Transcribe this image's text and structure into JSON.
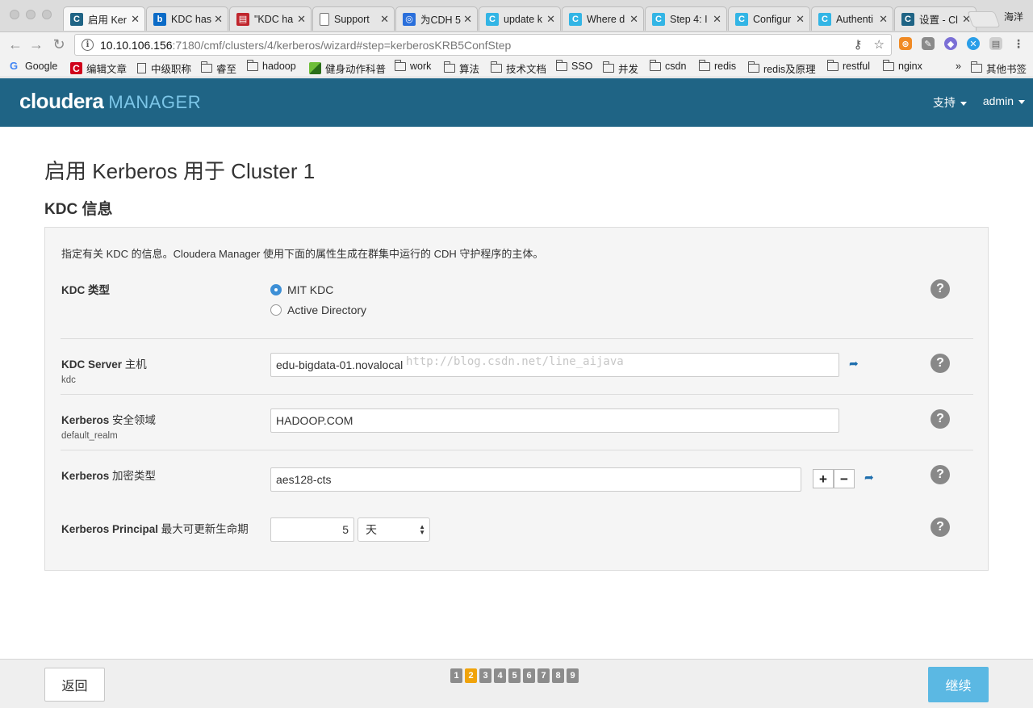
{
  "browser": {
    "profile": "海洋",
    "tabs": [
      {
        "title": "启用 Ker",
        "fav": "C",
        "color": "#1f6485",
        "active": true
      },
      {
        "title": "KDC has",
        "fav": "b",
        "color": "#0b6bc7",
        "active": false
      },
      {
        "title": "\"KDC ha",
        "fav": "▤",
        "color": "#c0262d",
        "active": false
      },
      {
        "title": "Support",
        "fav": "",
        "color": "#ffffff",
        "active": false
      },
      {
        "title": "为CDH 5",
        "fav": "◎",
        "color": "#2a6fdb",
        "active": false
      },
      {
        "title": "update k",
        "fav": "C",
        "color": "#33b5e5",
        "active": false
      },
      {
        "title": "Where d",
        "fav": "C",
        "color": "#33b5e5",
        "active": false
      },
      {
        "title": "Step 4: I",
        "fav": "C",
        "color": "#33b5e5",
        "active": false
      },
      {
        "title": "Configur",
        "fav": "C",
        "color": "#33b5e5",
        "active": false
      },
      {
        "title": "Authenti",
        "fav": "C",
        "color": "#33b5e5",
        "active": false
      },
      {
        "title": "设置 - Cl",
        "fav": "C",
        "color": "#1f6485",
        "active": false
      }
    ],
    "url_host": "10.10.106.156",
    "url_path": ":7180/cmf/clusters/4/kerberos/wizard#step=kerberosKRB5ConfStep",
    "bookmarks": {
      "google": "Google",
      "b1": "编辑文章",
      "b2": "中级职称",
      "b3": "睿至",
      "b4": "hadoop",
      "b5": "健身动作科普",
      "b6": "work",
      "b7": "算法",
      "b8": "技术文档",
      "b9": "SSO",
      "b10": "并发",
      "b11": "csdn",
      "b12": "redis",
      "b13": "redis及原理",
      "b14": "restful",
      "b15": "nginx",
      "more": "»",
      "other": "其他书签"
    }
  },
  "header": {
    "logo_main": "cloudera",
    "logo_sub": "MANAGER",
    "support": "支持",
    "user": "admin"
  },
  "page": {
    "title": "启用 Kerberos 用于 Cluster 1",
    "section": "KDC 信息",
    "description": "指定有关 KDC 的信息。Cloudera Manager 使用下面的属性生成在群集中运行的 CDH 守护程序的主体。",
    "kdc_type": {
      "label": "KDC 类型",
      "options": [
        "MIT KDC",
        "Active Directory"
      ]
    },
    "kdc_server": {
      "label_b": "KDC Server",
      "label_n": " 主机",
      "key": "kdc",
      "value": "edu-bigdata-01.novalocal"
    },
    "realm": {
      "label_b": "Kerberos",
      "label_n": " 安全领域",
      "key": "default_realm",
      "value": "HADOOP.COM"
    },
    "enc": {
      "label_b": "Kerberos",
      "label_n": " 加密类型",
      "value": "aes128-cts"
    },
    "lifetime": {
      "label_b": "Kerberos Principal",
      "label_n": " 最大可更新生命期",
      "value": "5",
      "unit": "天"
    },
    "watermark": "http://blog.csdn.net/line_aijava",
    "help": "?",
    "plus": "+",
    "minus": "−"
  },
  "footer": {
    "back": "返回",
    "next": "继续",
    "steps": [
      "1",
      "2",
      "3",
      "4",
      "5",
      "6",
      "7",
      "8",
      "9"
    ],
    "current_step": 2
  }
}
